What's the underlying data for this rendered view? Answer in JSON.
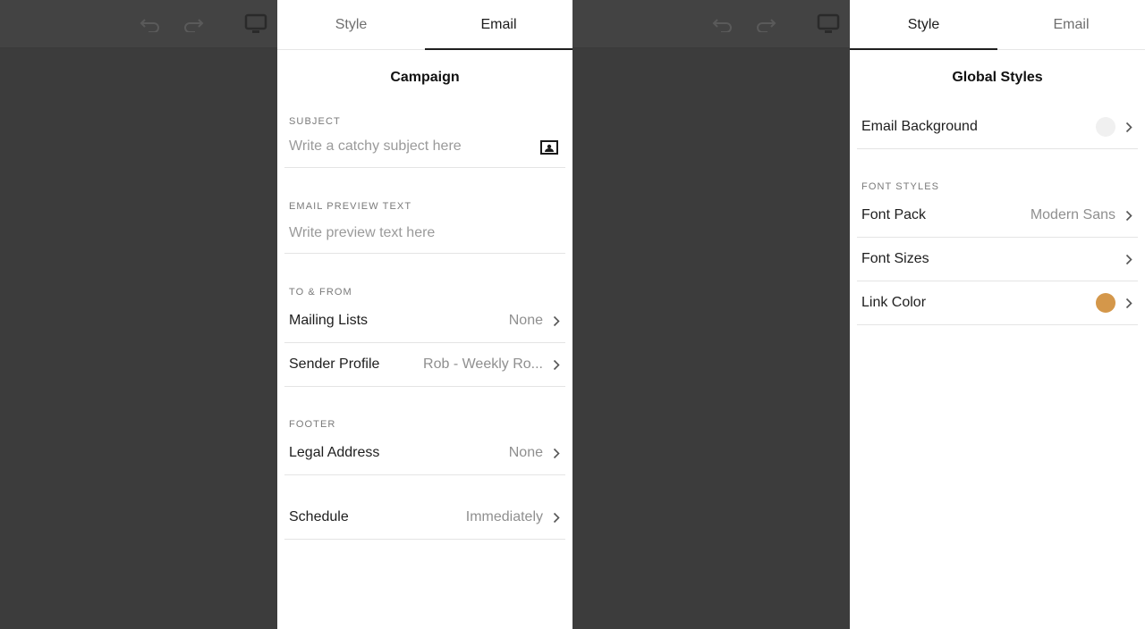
{
  "left_panel": {
    "tabs": [
      {
        "label": "Style",
        "active": false
      },
      {
        "label": "Email",
        "active": true
      }
    ],
    "title": "Campaign",
    "subject": {
      "label": "SUBJECT",
      "placeholder": "Write a catchy subject here",
      "icon": "personalize-icon"
    },
    "preview": {
      "label": "EMAIL PREVIEW TEXT",
      "placeholder": "Write preview text here"
    },
    "to_from": {
      "label": "TO & FROM",
      "rows": [
        {
          "label": "Mailing Lists",
          "value": "None"
        },
        {
          "label": "Sender Profile",
          "value": "Rob - Weekly Ro..."
        }
      ]
    },
    "footer": {
      "label": "FOOTER",
      "rows": [
        {
          "label": "Legal Address",
          "value": "None"
        }
      ]
    },
    "schedule": {
      "label": "Schedule",
      "value": "Immediately"
    }
  },
  "right_panel": {
    "tabs": [
      {
        "label": "Style",
        "active": true
      },
      {
        "label": "Email",
        "active": false
      }
    ],
    "title": "Global Styles",
    "email_background": {
      "label": "Email Background",
      "color": "#f0f0f0"
    },
    "font_styles": {
      "label": "FONT STYLES",
      "rows": [
        {
          "label": "Font Pack",
          "value": "Modern Sans"
        },
        {
          "label": "Font Sizes",
          "value": ""
        }
      ]
    },
    "link_color": {
      "label": "Link Color",
      "color": "#d4974a"
    }
  },
  "toolbar_icons": [
    "undo-icon",
    "redo-icon",
    "desktop-preview-icon"
  ],
  "colors": {
    "backdrop": "#414141",
    "panel": "#ffffff",
    "accent_tab": "#1f1f1f"
  }
}
